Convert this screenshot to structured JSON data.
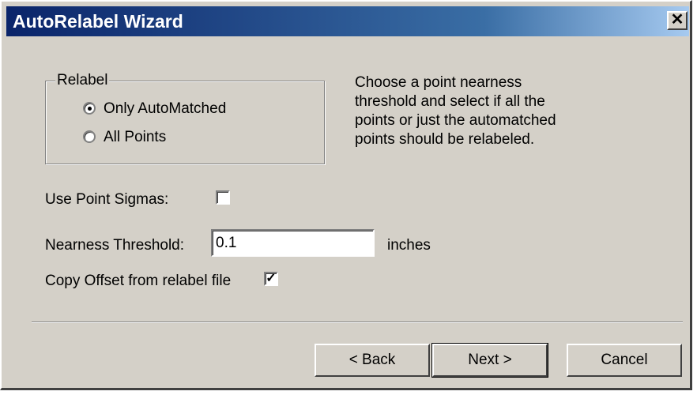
{
  "window": {
    "title": "AutoRelabel Wizard",
    "close_glyph": "✕"
  },
  "relabel_group": {
    "legend": "Relabel",
    "options": [
      {
        "label": "Only AutoMatched",
        "selected": true
      },
      {
        "label": "All Points",
        "selected": false
      }
    ]
  },
  "description": {
    "lines": [
      "Choose a point nearness",
      "threshold and select if all the",
      "points or just the automatched",
      "points should be relabeled."
    ]
  },
  "use_point_sigmas": {
    "label": "Use Point Sigmas:",
    "checked": false
  },
  "nearness_threshold": {
    "label": "Nearness Threshold:",
    "value": "0.1",
    "units": "inches"
  },
  "copy_offset": {
    "label": "Copy Offset from relabel file",
    "checked": true,
    "check_glyph": "✓"
  },
  "buttons": {
    "back": "< Back",
    "next": "Next >",
    "cancel": "Cancel"
  }
}
